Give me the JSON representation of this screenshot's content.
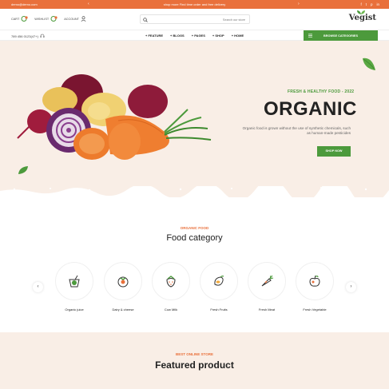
{
  "topbar": {
    "email": "demo@demo.com",
    "promo": "shop more Find time order and free delivery",
    "prev": "‹",
    "next": "›",
    "socials": [
      "f",
      "t",
      "p",
      "in"
    ]
  },
  "header": {
    "cart": "CART",
    "wishlist": "WISHLIST",
    "account": "ACCOUNT",
    "search_placeholder": "Search our store",
    "logo": "Vegist"
  },
  "nav": {
    "phone": "789 456 0123(47+)",
    "menu": [
      "FEATURE",
      "BLOGS",
      "PAGES",
      "SHOP",
      "HOME"
    ],
    "browse": "BROWSE CATEGORIES"
  },
  "hero": {
    "tag": "FRESH & HEALTHY FOOD - 2022",
    "title": "ORGANIC",
    "desc": "Organic food is grown without the use of synthetic chemicals, such as human-made pesticides",
    "button": "SHOP NOW"
  },
  "category": {
    "tag": "ORGANIC FOOD",
    "title": "Food category",
    "prev": "‹",
    "next": "›",
    "items": [
      {
        "label": "Organic juice",
        "icon": "juice-icon"
      },
      {
        "label": "Dairy & cheese",
        "icon": "tomato-icon"
      },
      {
        "label": "Cow Milk",
        "icon": "strawberry-icon"
      },
      {
        "label": "Fresh Fruits",
        "icon": "mango-icon"
      },
      {
        "label": "Fresh Meat",
        "icon": "carrot-icon"
      },
      {
        "label": "Fresh Vegetable",
        "icon": "apple-icon"
      }
    ]
  },
  "featured": {
    "tag": "BEST ONLINE STORE",
    "title": "Featured product"
  },
  "colors": {
    "accent_orange": "#e9703b",
    "accent_green": "#4c9a3c",
    "hero_bg": "#f9eee6"
  }
}
